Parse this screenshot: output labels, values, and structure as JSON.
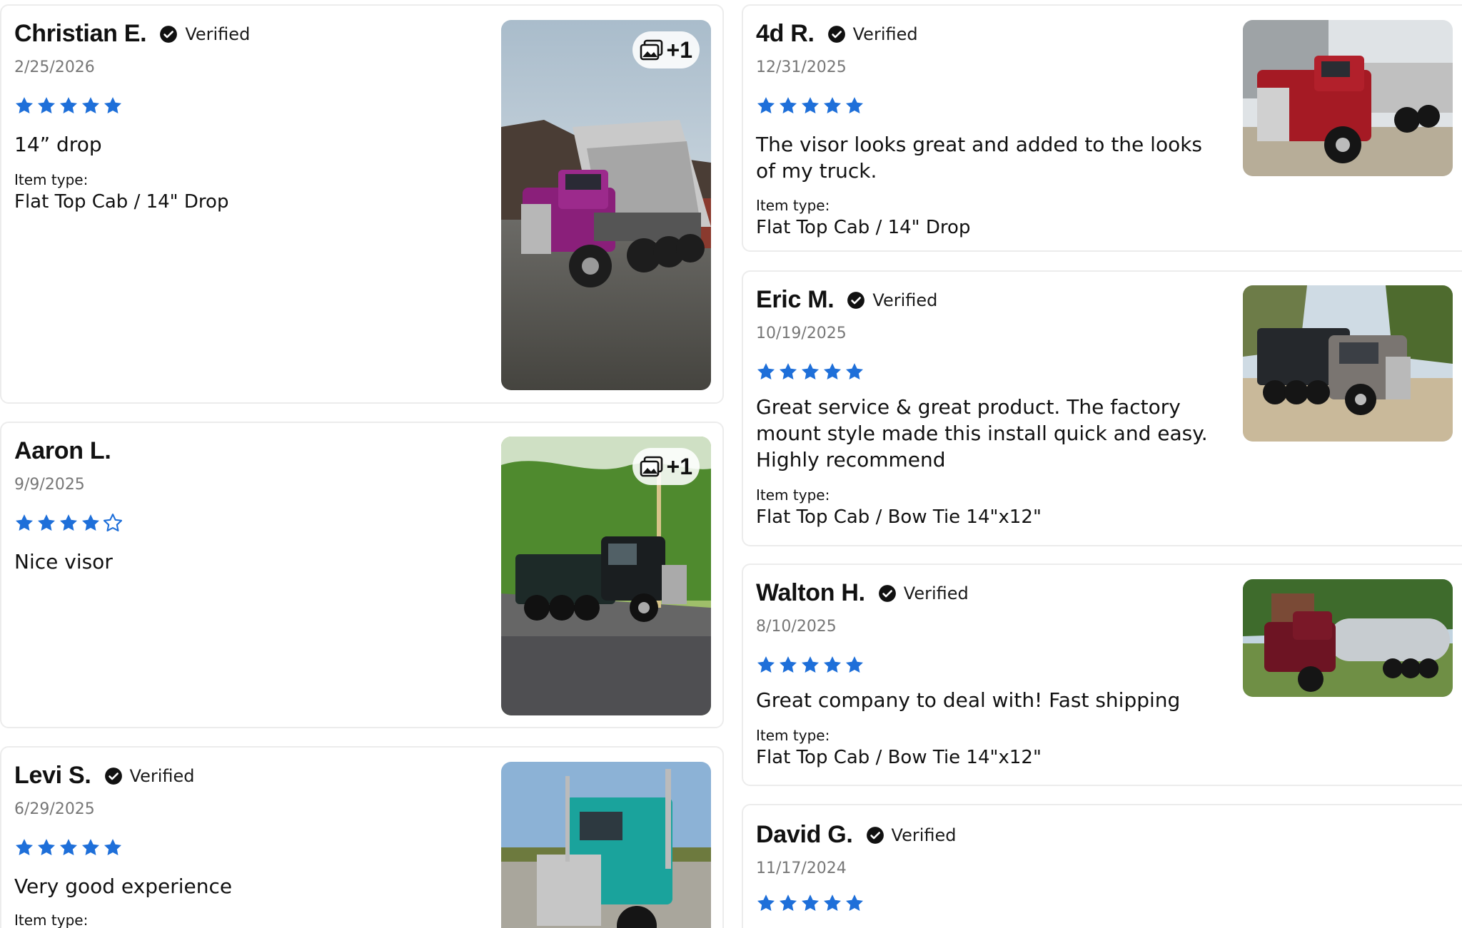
{
  "colors": {
    "star": "#1e6fd9",
    "verified_badge": "#111111",
    "card_border": "#ececec"
  },
  "verified_icon": "check-badge-icon",
  "star_icon": "star-icon",
  "left_column": [
    {
      "name": "Christian E.",
      "verified": true,
      "verified_label": "Verified",
      "date": "2/25/2026",
      "rating": 5,
      "max_rating": 5,
      "title": "14” drop",
      "item_type_label": "Item type:",
      "item_type": "Flat Top Cab / 14\" Drop",
      "photo_more": "+1",
      "photo_subject": "purple dump truck"
    },
    {
      "name": "Aaron L.",
      "verified": false,
      "date": "9/9/2025",
      "rating": 4,
      "max_rating": 5,
      "title": "Nice visor",
      "photo_more": "+1",
      "photo_subject": "black dump truck"
    },
    {
      "name": "Levi S.",
      "verified": true,
      "verified_label": "Verified",
      "date": "6/29/2025",
      "rating": 5,
      "max_rating": 5,
      "title": "Very good experience",
      "item_type_label": "Item type:",
      "photo_subject": "teal semi truck"
    }
  ],
  "right_column": [
    {
      "name": "4d R.",
      "verified": true,
      "verified_label": "Verified",
      "date": "12/31/2025",
      "rating": 5,
      "max_rating": 5,
      "title_lines": [
        "The visor looks great and added to the looks",
        "of my truck."
      ],
      "item_type_label": "Item type:",
      "item_type": "Flat Top Cab / 14\" Drop",
      "photo_subject": "red semi truck"
    },
    {
      "name": "Eric M.",
      "verified": true,
      "verified_label": "Verified",
      "date": "10/19/2025",
      "rating": 5,
      "max_rating": 5,
      "title_lines": [
        "Great service & great product. The factory",
        "mount style made this install quick and easy.",
        "Highly recommend"
      ],
      "item_type_label": "Item type:",
      "item_type": "Flat Top Cab / Bow Tie 14\"x12\"",
      "photo_subject": "gray dump truck"
    },
    {
      "name": "Walton H.",
      "verified": true,
      "verified_label": "Verified",
      "date": "8/10/2025",
      "rating": 5,
      "max_rating": 5,
      "title_lines": [
        "Great company to deal with! Fast shipping"
      ],
      "item_type_label": "Item type:",
      "item_type": "Flat Top Cab / Bow Tie 14\"x12\"",
      "photo_subject": "maroon tanker truck"
    },
    {
      "name": "David G.",
      "verified": true,
      "verified_label": "Verified",
      "date": "11/17/2024",
      "rating": 5,
      "max_rating": 5
    }
  ]
}
